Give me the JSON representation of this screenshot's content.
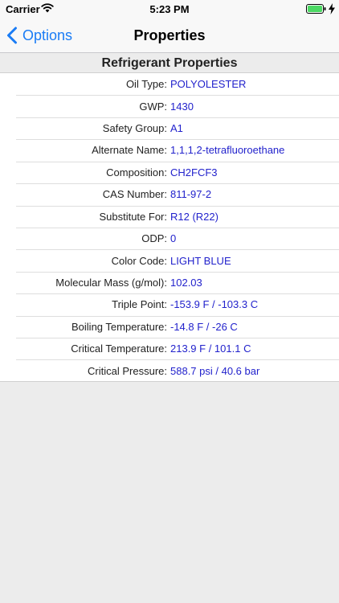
{
  "status_bar": {
    "carrier": "Carrier",
    "time": "5:23 PM",
    "icons": [
      "wifi-icon",
      "battery-icon",
      "charging-bolt-icon"
    ]
  },
  "nav": {
    "back_label": "Options",
    "title": "Properties"
  },
  "section": {
    "title": "Refrigerant Properties"
  },
  "properties": [
    {
      "label": "Oil Type:",
      "value": "POLYOLESTER"
    },
    {
      "label": "GWP:",
      "value": "1430"
    },
    {
      "label": "Safety Group:",
      "value": "A1"
    },
    {
      "label": "Alternate Name:",
      "value": "1,1,1,2-tetrafluoroethane"
    },
    {
      "label": "Composition:",
      "value": "CH2FCF3"
    },
    {
      "label": "CAS Number:",
      "value": "811-97-2"
    },
    {
      "label": "Substitute For:",
      "value": "R12 (R22)"
    },
    {
      "label": "ODP:",
      "value": "0"
    },
    {
      "label": "Color Code:",
      "value": "LIGHT BLUE"
    },
    {
      "label": "Molecular Mass (g/mol):",
      "value": "102.03"
    },
    {
      "label": "Triple Point:",
      "value": "-153.9 F / -103.3 C"
    },
    {
      "label": "Boiling Temperature:",
      "value": "-14.8 F / -26 C"
    },
    {
      "label": "Critical Temperature:",
      "value": "213.9 F / 101.1 C"
    },
    {
      "label": "Critical Pressure:",
      "value": "588.7 psi / 40.6 bar"
    }
  ],
  "colors": {
    "accent": "#1a7cf5",
    "value_text": "#2222cc",
    "battery": "#4cd964",
    "background": "#ececec"
  }
}
